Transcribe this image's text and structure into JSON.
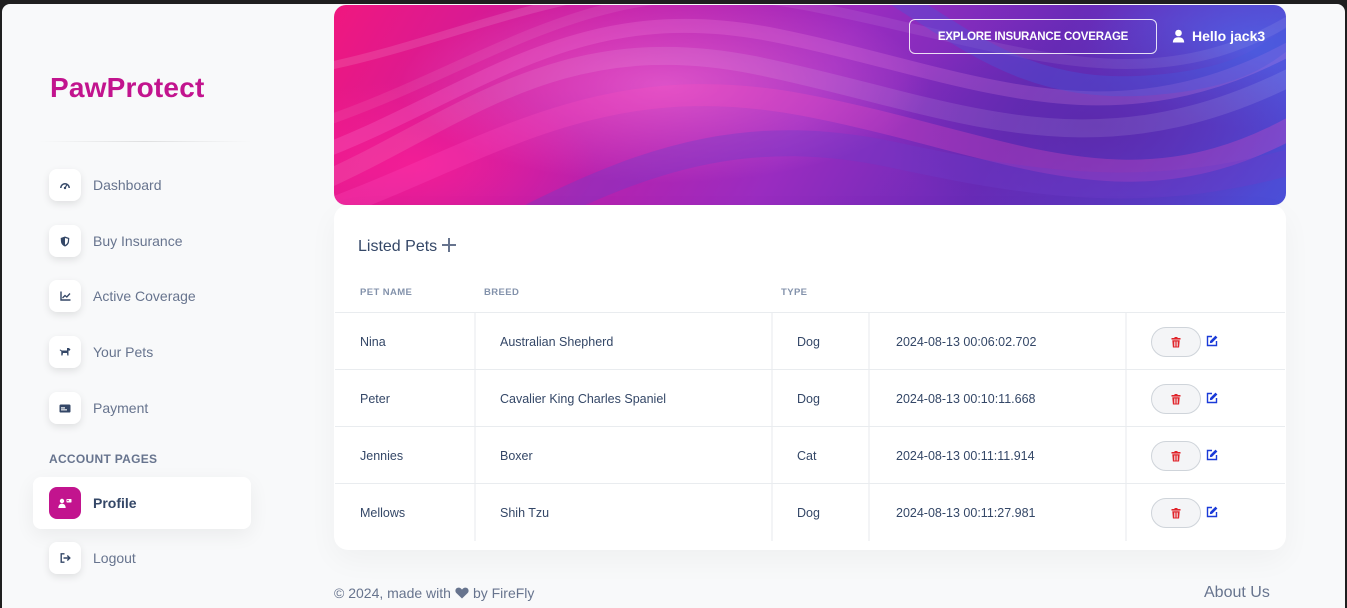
{
  "brand": {
    "name": "PawProtect",
    "color": "#c2148e"
  },
  "sidebar": {
    "items": [
      {
        "label": "Dashboard",
        "icon": "dashboard-gauge-icon"
      },
      {
        "label": "Buy Insurance",
        "icon": "shield-icon"
      },
      {
        "label": "Active Coverage",
        "icon": "line-chart-icon"
      },
      {
        "label": "Your Pets",
        "icon": "dog-icon"
      },
      {
        "label": "Payment",
        "icon": "credit-card-icon"
      }
    ],
    "section_heading": "ACCOUNT PAGES",
    "account_items": [
      {
        "label": "Profile",
        "icon": "user-profile-icon",
        "active": true
      },
      {
        "label": "Logout",
        "icon": "logout-icon"
      }
    ]
  },
  "header": {
    "explore_label": "EXPLORE INSURANCE COVERAGE",
    "greeting": "Hello jack3"
  },
  "pets": {
    "title": "Listed Pets",
    "columns": [
      "PET NAME",
      "BREED",
      "TYPE"
    ],
    "rows": [
      {
        "name": "Nina",
        "breed": "Australian Shepherd",
        "type": "Dog",
        "created": "2024-08-13 00:06:02.702"
      },
      {
        "name": "Peter",
        "breed": "Cavalier King Charles Spaniel",
        "type": "Dog",
        "created": "2024-08-13 00:10:11.668"
      },
      {
        "name": "Jennies",
        "breed": "Boxer",
        "type": "Cat",
        "created": "2024-08-13 00:11:11.914"
      },
      {
        "name": "Mellows",
        "breed": "Shih Tzu",
        "type": "Dog",
        "created": "2024-08-13 00:11:27.981"
      }
    ]
  },
  "footer": {
    "prefix": "© 2024, made with",
    "suffix": "by FireFly",
    "about": "About Us"
  },
  "colors": {
    "accent": "#c2148e",
    "delete_icon": "#e0242b",
    "edit_icon": "#1a3ad8",
    "text_muted": "#67748e",
    "text_dark": "#344767"
  }
}
